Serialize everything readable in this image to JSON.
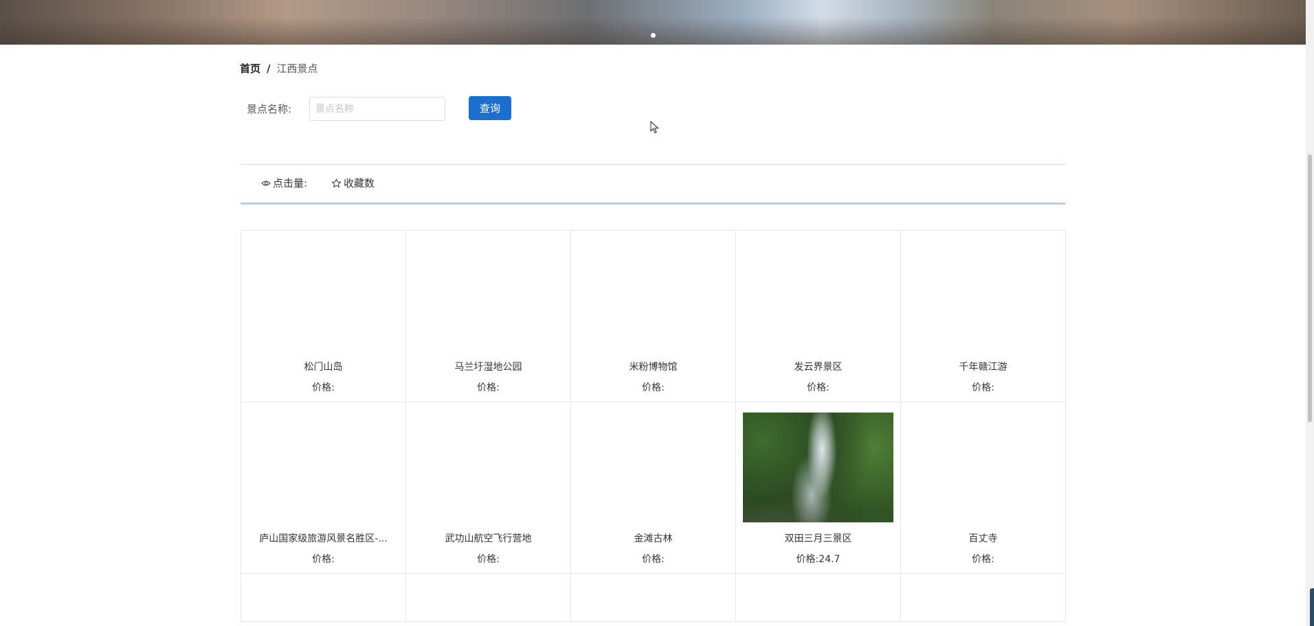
{
  "breadcrumb": {
    "home": "首页",
    "separator": "/",
    "current": "江西景点"
  },
  "search": {
    "label": "景点名称:",
    "placeholder": "景点名称",
    "value": "",
    "button_label": "查询"
  },
  "sort": {
    "clicks_label": "点击量:",
    "favorites_label": "收藏数"
  },
  "price_prefix": "价格:",
  "attractions": [
    {
      "name": "松门山岛",
      "price": "价格:",
      "has_image": false
    },
    {
      "name": "马兰圩湿地公园",
      "price": "价格:",
      "has_image": false
    },
    {
      "name": "米粉博物馆",
      "price": "价格:",
      "has_image": false
    },
    {
      "name": "发云界景区",
      "price": "价格:",
      "has_image": false
    },
    {
      "name": "千年赣江游",
      "price": "价格:",
      "has_image": false
    },
    {
      "name": "庐山国家级旅游风景名胜区-...",
      "price": "价格:",
      "has_image": false
    },
    {
      "name": "武功山航空飞行营地",
      "price": "价格:",
      "has_image": false
    },
    {
      "name": "金滩古林",
      "price": "价格:",
      "has_image": false
    },
    {
      "name": "双田三月三景区",
      "price": "价格:24.7",
      "has_image": true
    },
    {
      "name": "百丈寺",
      "price": "价格:",
      "has_image": false
    }
  ],
  "icons": {
    "clicks": "eye-icon",
    "favorites": "star-icon"
  },
  "colors": {
    "primary": "#1d6fce",
    "sort_border": "#b7cee4",
    "card_border": "#e4e7ed"
  }
}
